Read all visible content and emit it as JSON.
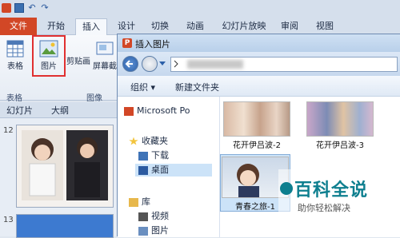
{
  "ribbon": {
    "tabs": [
      "文件",
      "开始",
      "插入",
      "设计",
      "切换",
      "动画",
      "幻灯片放映",
      "审阅",
      "视图"
    ],
    "buttons": {
      "table": "表格",
      "picture": "图片",
      "clipart": "剪贴画",
      "screenshot": "屏幕截"
    },
    "groups": {
      "table": "表格",
      "images": "图像"
    }
  },
  "slides_panel": {
    "tabs": [
      "幻灯片",
      "大纲"
    ],
    "slide_numbers": [
      "12",
      "13"
    ]
  },
  "dialog": {
    "title": "插入图片",
    "toolbar": {
      "organize": "组织 ▾",
      "new_folder": "新建文件夹"
    },
    "nav": {
      "app": "Microsoft Po",
      "favorites": "收藏夹",
      "downloads": "下载",
      "desktop": "桌面",
      "library": "库",
      "videos": "视频",
      "pictures": "图片"
    },
    "files": [
      {
        "label": "花开伊吕波-2"
      },
      {
        "label": "花开伊吕波-3"
      },
      {
        "label": "青春之旅-1"
      }
    ]
  },
  "watermark": {
    "title": "百科全说",
    "subtitle": "助你轻松解决"
  },
  "colors": {
    "accent": "#d24726",
    "highlight": "#e03030",
    "selection": "#cce3f8"
  }
}
